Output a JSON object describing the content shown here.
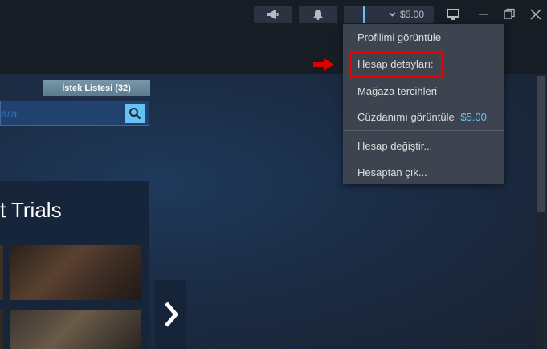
{
  "titlebar": {
    "balance": "$5.00",
    "icons": [
      "megaphone-icon",
      "bell-icon",
      "monitor-icon",
      "minimize-icon",
      "restore-icon",
      "close-icon"
    ]
  },
  "store": {
    "wishlist_label": "İstek Listesi (32)",
    "search_placeholder_fragment": "ara",
    "section_title_fragment": "t Trials"
  },
  "account_menu": {
    "items": [
      {
        "label": "Profilimi görüntüle"
      },
      {
        "label": "Hesap detayları:"
      },
      {
        "label": "Mağaza tercihleri"
      },
      {
        "label": "Cüzdanımı görüntüle",
        "value": "$5.00"
      },
      {
        "label": "Hesap değiştir..."
      },
      {
        "label": "Hesaptan çık..."
      }
    ]
  },
  "colors": {
    "menu_bg": "#3d4450",
    "wallet_accent": "#67c1f5",
    "highlight_border": "#e00000",
    "arrow": "#e00000"
  }
}
